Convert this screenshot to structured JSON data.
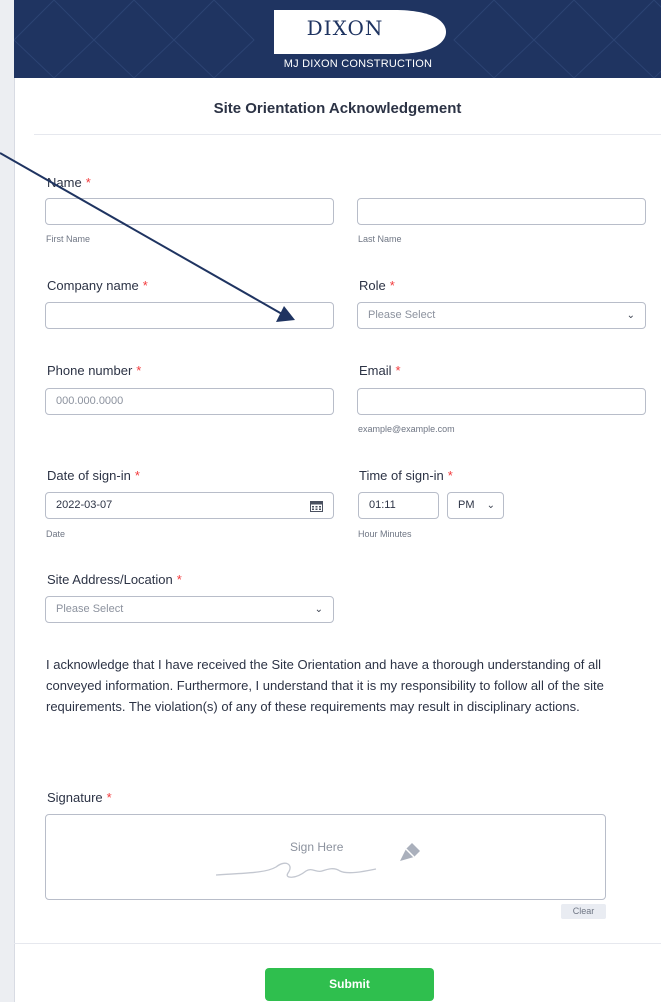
{
  "header": {
    "logo_name": "DIXON",
    "logo_subtitle": "MJ DIXON CONSTRUCTION",
    "banner_color": "#1f3461"
  },
  "form": {
    "title": "Site Orientation Acknowledgement",
    "required_marker": "*",
    "name": {
      "label": "Name",
      "first_sub": "First Name",
      "last_sub": "Last Name",
      "first_value": "",
      "last_value": ""
    },
    "company": {
      "label": "Company name",
      "value": ""
    },
    "role": {
      "label": "Role",
      "placeholder": "Please Select"
    },
    "phone": {
      "label": "Phone number",
      "placeholder": "000.000.0000"
    },
    "email": {
      "label": "Email",
      "value": "",
      "sub": "example@example.com"
    },
    "date": {
      "label": "Date of sign-in",
      "value": "2022-03-07",
      "sub": "Date"
    },
    "time": {
      "label": "Time of sign-in",
      "value": "01:11",
      "ampm": "PM",
      "sub": "Hour Minutes"
    },
    "site": {
      "label": "Site Address/Location",
      "placeholder": "Please Select"
    },
    "acknowledgement": "I acknowledge that I have received the Site Orientation and have a thorough understanding of all conveyed information. Furthermore, I understand that it is my responsibility to follow all of the site requirements. The violation(s) of any of these requirements may result in disciplinary actions.",
    "signature": {
      "label": "Signature",
      "placeholder": "Sign Here",
      "clear_label": "Clear"
    },
    "submit_label": "Submit"
  },
  "colors": {
    "accent_submit": "#2fbf4e",
    "required": "#f23a3c",
    "annotation_arrow": "#1f3461"
  },
  "icons": {
    "calendar": "calendar-icon",
    "chevron": "chevron-down-icon",
    "pen": "pen-icon"
  }
}
